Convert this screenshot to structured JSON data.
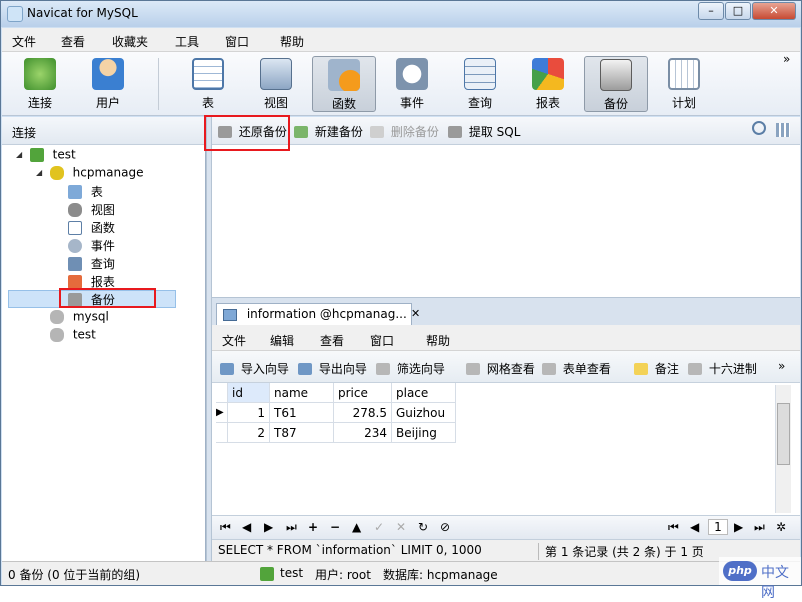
{
  "window": {
    "title": "Navicat for MySQL",
    "controls": {
      "minimize": "–",
      "maximize": "□",
      "close": "✕"
    }
  },
  "menu": [
    "文件",
    "查看",
    "收藏夹",
    "工具",
    "窗口",
    "帮助"
  ],
  "toolbar": {
    "buttons": [
      {
        "label": "连接",
        "icon": "connection-icon"
      },
      {
        "label": "用户",
        "icon": "user-icon"
      },
      {
        "label": "表",
        "icon": "table-icon"
      },
      {
        "label": "视图",
        "icon": "view-icon"
      },
      {
        "label": "函数",
        "icon": "function-icon"
      },
      {
        "label": "事件",
        "icon": "event-icon"
      },
      {
        "label": "查询",
        "icon": "query-icon"
      },
      {
        "label": "报表",
        "icon": "report-icon"
      },
      {
        "label": "备份",
        "icon": "backup-icon"
      },
      {
        "label": "计划",
        "icon": "schedule-icon"
      }
    ],
    "active": "备份",
    "overflow": "»"
  },
  "left_pane": {
    "header": "连接",
    "tree": [
      {
        "label": "test",
        "icon": "connection-icon",
        "arrow": "◢"
      },
      {
        "label": "hcpmanage",
        "icon": "database-open-icon",
        "arrow": "◢"
      },
      {
        "label": "表",
        "icon": "table-icon"
      },
      {
        "label": "视图",
        "icon": "view-icon"
      },
      {
        "label": "函数",
        "icon": "function-icon"
      },
      {
        "label": "事件",
        "icon": "event-icon"
      },
      {
        "label": "查询",
        "icon": "query-icon"
      },
      {
        "label": "报表",
        "icon": "report-icon"
      },
      {
        "label": "备份",
        "icon": "backup-icon"
      },
      {
        "label": "mysql",
        "icon": "database-icon"
      },
      {
        "label": "test",
        "icon": "database-icon"
      }
    ],
    "selected": "备份"
  },
  "backup_toolbar": {
    "restore": "还原备份",
    "new": "新建备份",
    "delete": "删除备份",
    "extract": "提取 SQL"
  },
  "table_window": {
    "tab_title": "information @hcpmanag...",
    "tab_close": "✕",
    "menu": [
      "文件",
      "编辑",
      "查看",
      "窗口",
      "帮助"
    ],
    "toolbar": {
      "import": "导入向导",
      "export": "导出向导",
      "filter": "筛选向导",
      "grid_view": "网格查看",
      "form_view": "表单查看",
      "note": "备注",
      "hex": "十六进制",
      "overflow": "»"
    },
    "columns": [
      "id",
      "name",
      "price",
      "place"
    ],
    "rows": [
      [
        "1",
        "T61",
        "278.5",
        "Guizhou"
      ],
      [
        "2",
        "T87",
        "234",
        "Beijing"
      ]
    ],
    "row_indicator": "▶",
    "nav_page": "1",
    "sql": "SELECT * FROM `information` LIMIT 0, 1000",
    "record_info": "第 1 条记录 (共 2 条) 于 1 页"
  },
  "status": {
    "left": "0 备份 (0 位于当前的组)",
    "connection": "test",
    "user": "用户: root",
    "database": "数据库: hcpmanage"
  },
  "watermark": {
    "logo": "php",
    "text": "中文网"
  },
  "colors": {
    "highlight": "#e8191e",
    "selection": "#cde3f9",
    "frame": "#cfe0f2"
  }
}
